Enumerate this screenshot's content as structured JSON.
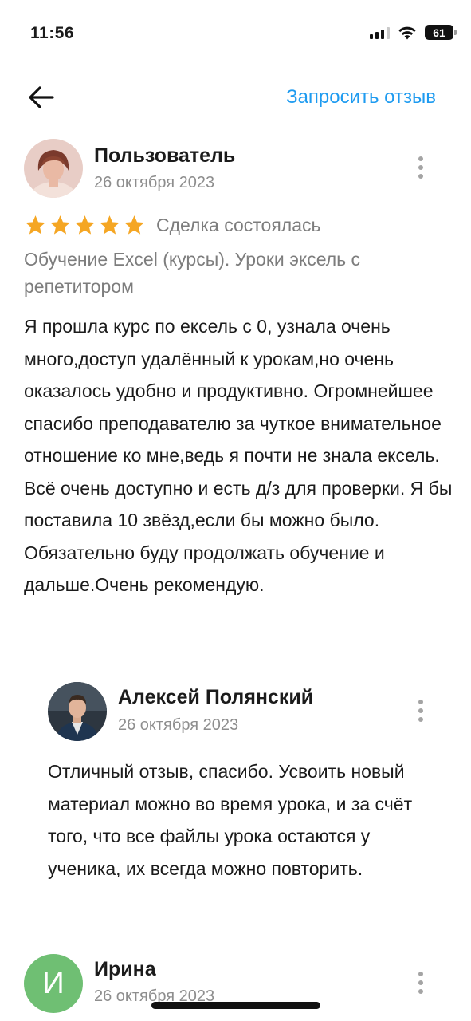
{
  "status_bar": {
    "time": "11:56",
    "battery": "61",
    "icons": [
      "signal-icon",
      "wifi-icon",
      "battery-icon"
    ]
  },
  "nav": {
    "back_icon": "arrow-left-icon",
    "request_review": "Запросить отзыв"
  },
  "review": {
    "author": "Пользователь",
    "date": "26 октября 2023",
    "rating": 5,
    "rating_max": 5,
    "deal_status": "Сделка состоялась",
    "service": "Обучение Excel (курсы). Уроки эксель с репетитором",
    "text": "Я прошла курс по ексель с 0, узнала очень много,доступ удалённый к урокам,но очень оказалось удобно и продуктивно. Огромнейшее спасибо преподавателю за чуткое внимательное отношение ко мне,ведь я почти не знала ексель. Всё очень доступно и есть д/з для проверки. Я бы поставила 10 звёзд,если бы можно было. Обязательно буду продолжать обучение и дальше.Очень рекомендую."
  },
  "reply": {
    "author": "Алексей Полянский",
    "date": "26 октября 2023",
    "text": "Отличный отзыв, спасибо. Усвоить новый материал можно во время урока, и за счёт того, что все файлы урока остаются у ученика, их всегда можно повторить."
  },
  "next_review": {
    "author": "Ирина",
    "avatar_letter": "И",
    "date": "26 октября 2023"
  },
  "colors": {
    "accent": "#1e9bf0",
    "star": "#f5a623",
    "avatar_green": "#6fbf73",
    "secondary_text": "#8e8e8e"
  }
}
